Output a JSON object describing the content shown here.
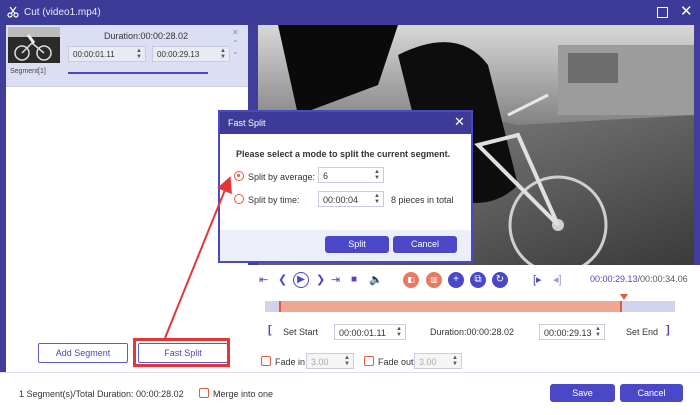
{
  "window": {
    "title": "Cut (video1.mp4)"
  },
  "segment": {
    "duration": "Duration:00:00:28.02",
    "start": "00:00:01.11",
    "end": "00:00:29.13",
    "label": "Segment[1]"
  },
  "left_buttons": {
    "add_segment": "Add Segment",
    "fast_split": "Fast Split"
  },
  "player": {
    "current_time": "00:00:29.13",
    "total_time": "/00:00:34.06"
  },
  "cut_row": {
    "set_start": "Set Start",
    "start_value": "00:00:01.11",
    "duration": "Duration:00:00:28.02",
    "end_value": "00:00:29.13",
    "set_end": "Set End"
  },
  "fades": {
    "fade_in_label": "Fade in",
    "fade_in_value": "3.00",
    "fade_out_label": "Fade out",
    "fade_out_value": "3.00"
  },
  "bottom": {
    "total": "1 Segment(s)/Total Duration: 00:00:28.02",
    "merge_label": "Merge into one",
    "save": "Save",
    "cancel": "Cancel"
  },
  "dialog": {
    "title": "Fast Split",
    "prompt": "Please select a mode to split the current segment.",
    "by_average_label": "Split by average:",
    "by_average_value": "6",
    "by_time_label": "Split by time:",
    "by_time_value": "00:00:04",
    "pieces_text": "8 pieces in total",
    "split_button": "Split",
    "cancel_button": "Cancel",
    "selected_mode": "Split by average"
  },
  "colors": {
    "accent": "#4b48c8",
    "title_bar": "#3d3b98",
    "highlight_red": "#e53535",
    "selection_orange": "#e25a3a"
  }
}
